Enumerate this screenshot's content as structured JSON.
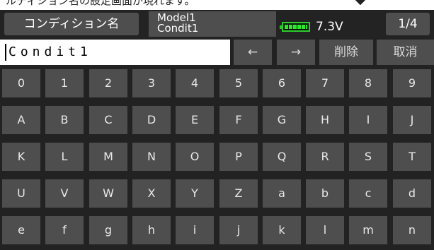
{
  "caption": {
    "text": "ルディション名の設定画面が現れます。",
    "arrow": "◆"
  },
  "header": {
    "title": "コンディション名",
    "model_name": "Model1",
    "condition_name": "Condit1",
    "voltage": "7.3V",
    "page": "1/4",
    "battery_color": "#2ecc2e"
  },
  "input": {
    "value": "Condit1"
  },
  "actions": {
    "left": "←",
    "right": "→",
    "delete": "削除",
    "cancel": "取消"
  },
  "keyboard": {
    "rows": [
      [
        "0",
        "1",
        "2",
        "3",
        "4",
        "5",
        "6",
        "7",
        "8",
        "9"
      ],
      [
        "A",
        "B",
        "C",
        "D",
        "E",
        "F",
        "G",
        "H",
        "I",
        "J"
      ],
      [
        "K",
        "L",
        "M",
        "N",
        "O",
        "P",
        "Q",
        "R",
        "S",
        "T"
      ],
      [
        "U",
        "V",
        "W",
        "X",
        "Y",
        "Z",
        "a",
        "b",
        "c",
        "d"
      ],
      [
        "e",
        "f",
        "g",
        "h",
        "i",
        "j",
        "k",
        "l",
        "m",
        "n"
      ]
    ]
  }
}
